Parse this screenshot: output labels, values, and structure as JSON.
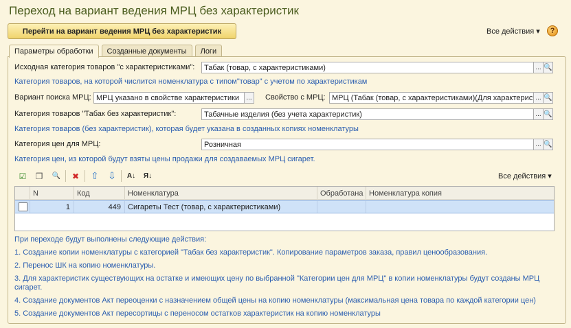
{
  "window": {
    "title": "Переход на вариант ведения МРЦ без характеристик"
  },
  "header": {
    "main_button": "Перейти на вариант ведения МРЦ без характеристик",
    "all_actions": "Все действия ▾",
    "help": "?"
  },
  "tabs": [
    {
      "label": "Параметры обработки",
      "active": true
    },
    {
      "label": "Созданные документы",
      "active": false
    },
    {
      "label": "Логи",
      "active": false
    }
  ],
  "form": {
    "source_category_label": "Исходная категория товаров \"с характеристиками\":",
    "source_category_value": "Табак (товар, с характеристиками)",
    "source_category_hint": "Категория товаров, на которой числится номенклатура с типом\"товар\" с учетом по характеристикам",
    "search_variant_label": "Вариант поиска МРЦ:",
    "search_variant_value": "МРЦ указано в свойстве характеристики",
    "property_label": "Свойство с МРЦ:",
    "property_value": "МРЦ (Табак (товар, с характеристиками)(Для характеристик))",
    "target_category_label": "Категория товаров \"Табак без характеристик\":",
    "target_category_value": "Табачные изделия (без учета характеристик)",
    "target_category_hint": "Категория товаров (без характеристик), которая будет указана в созданных копиях номенклатуры",
    "price_category_label": "Категория цен для МРЦ:",
    "price_category_value": "Розничная",
    "price_category_hint": "Категория цен, из которой будут взяты цены продажи для создаваемых МРЦ сигарет.",
    "select_glyph": "...",
    "search_glyph": "🔍"
  },
  "toolbar": {
    "all_actions": "Все действия ▾",
    "icons": [
      "check-all-icon",
      "copy-icon",
      "find-icon",
      "delete-icon",
      "move-up-icon",
      "move-down-icon",
      "sort-asc-icon",
      "sort-desc-icon"
    ],
    "glyphs": {
      "check_all": "☑",
      "copy": "❐",
      "find": "🔍",
      "delete": "✖",
      "up": "⇧",
      "down": "⇩",
      "sort_asc": "A↓",
      "sort_desc": "Я↓"
    }
  },
  "table": {
    "columns": [
      "",
      "N",
      "Код",
      "Номенклатура",
      "Обработана",
      "Номенклатура копия"
    ],
    "rows": [
      {
        "checked": false,
        "n": "1",
        "code": "449",
        "name": "Сигареты Тест (товар, с характеристиками)",
        "processed": "",
        "copy": ""
      }
    ]
  },
  "info": {
    "intro": "При переходе будут выполнены следующие действия:",
    "step1": "1. Создание копии номенклатуры с категорией \"Табак без характеристик\". Копирование параметров заказа, правил ценообразования.",
    "step2": "2. Перенос ШК на копию номенклатуры.",
    "step3a": "3. Для характеристик существующих на остатке и имеющих цену по выбранной \"Категории цен для МРЦ\"  в копии номенклатуры будут  созданы МРЦ",
    "step3b": "сигарет.",
    "step4": "4. Создание документов Акт переоценки с назначением общей цены на копию номенклатуры (максимальная цена товара по каждой категории цен)",
    "step5": "5. Создание документов Акт пересортицы с переносом остатков характеристик на копию номенклатуры"
  },
  "colors": {
    "title": "#4b5d1f",
    "hint": "#2a5db0",
    "background": "#fbf5df",
    "selected_row": "#cfe2f8",
    "delete_icon": "#d12a2a",
    "arrow_icon": "#2f77c8"
  }
}
